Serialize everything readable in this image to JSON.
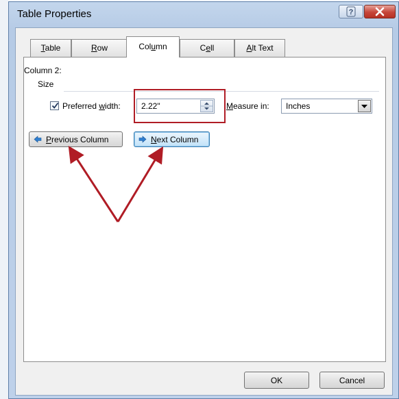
{
  "window": {
    "title": "Table Properties",
    "help_icon": "question-mark-icon",
    "close_icon": "close-x-icon"
  },
  "tabs": [
    {
      "pre": "",
      "key": "T",
      "post": "able",
      "active": false
    },
    {
      "pre": "",
      "key": "R",
      "post": "ow",
      "active": false
    },
    {
      "pre": "Col",
      "key": "u",
      "post": "mn",
      "active": true
    },
    {
      "pre": "C",
      "key": "e",
      "post": "ll",
      "active": false
    },
    {
      "pre": "",
      "key": "A",
      "post": "lt Text",
      "active": false
    }
  ],
  "column": {
    "heading": "Column 2:",
    "size_group_label": "Size",
    "preferred_width": {
      "checked": true,
      "label_pre": "Preferred ",
      "label_key": "w",
      "label_post": "idth:",
      "value": "2.22\""
    },
    "measure_in": {
      "label_key": "M",
      "label_post": "easure in:",
      "selected": "Inches"
    },
    "previous_button": {
      "pre": "",
      "key": "P",
      "post": "revious Column",
      "icon": "left-arrow-icon"
    },
    "next_button": {
      "pre": "",
      "key": "N",
      "post": "ext Column",
      "icon": "right-arrow-icon"
    }
  },
  "footer": {
    "ok_label": "OK",
    "cancel_label": "Cancel"
  },
  "annotations": {
    "color": "#b01c25"
  }
}
